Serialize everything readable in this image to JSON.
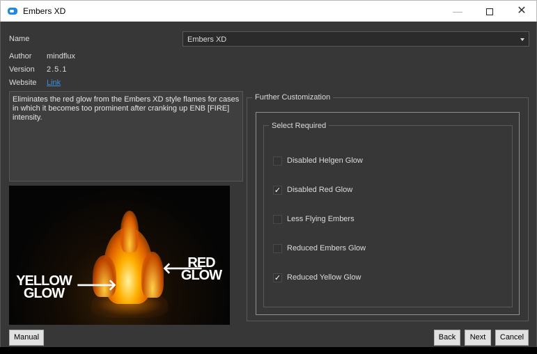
{
  "window": {
    "title": "Embers XD",
    "controls": {
      "minimize": "—",
      "close": "✕"
    }
  },
  "info": {
    "name_label": "Name",
    "name_value": "Embers XD",
    "author_label": "Author",
    "author_value": "mindflux",
    "version_label": "Version",
    "version_value": "2.5.1",
    "website_label": "Website",
    "website_value": "Link"
  },
  "description": "Eliminates the red glow from the Embers XD style flames for cases in which it becomes too prominent after cranking up ENB [FIRE] intensity.",
  "preview": {
    "left_text": [
      "YELLOW",
      "GLOW"
    ],
    "right_text": [
      "RED",
      "GLOW"
    ]
  },
  "customization": {
    "title": "Further Customization",
    "group_title": "Select Required",
    "options": [
      {
        "label": "Disabled Helgen Glow",
        "checked": false
      },
      {
        "label": "Disabled Red Glow",
        "checked": true
      },
      {
        "label": "Less Flying Embers",
        "checked": false
      },
      {
        "label": "Reduced Embers Glow",
        "checked": false
      },
      {
        "label": "Reduced Yellow Glow",
        "checked": true
      }
    ]
  },
  "buttons": {
    "manual": "Manual",
    "back": "Back",
    "next": "Next",
    "cancel": "Cancel"
  },
  "colors": {
    "background": "#373737",
    "link": "#3d8fe0",
    "app_icon": "#1e88e5"
  }
}
